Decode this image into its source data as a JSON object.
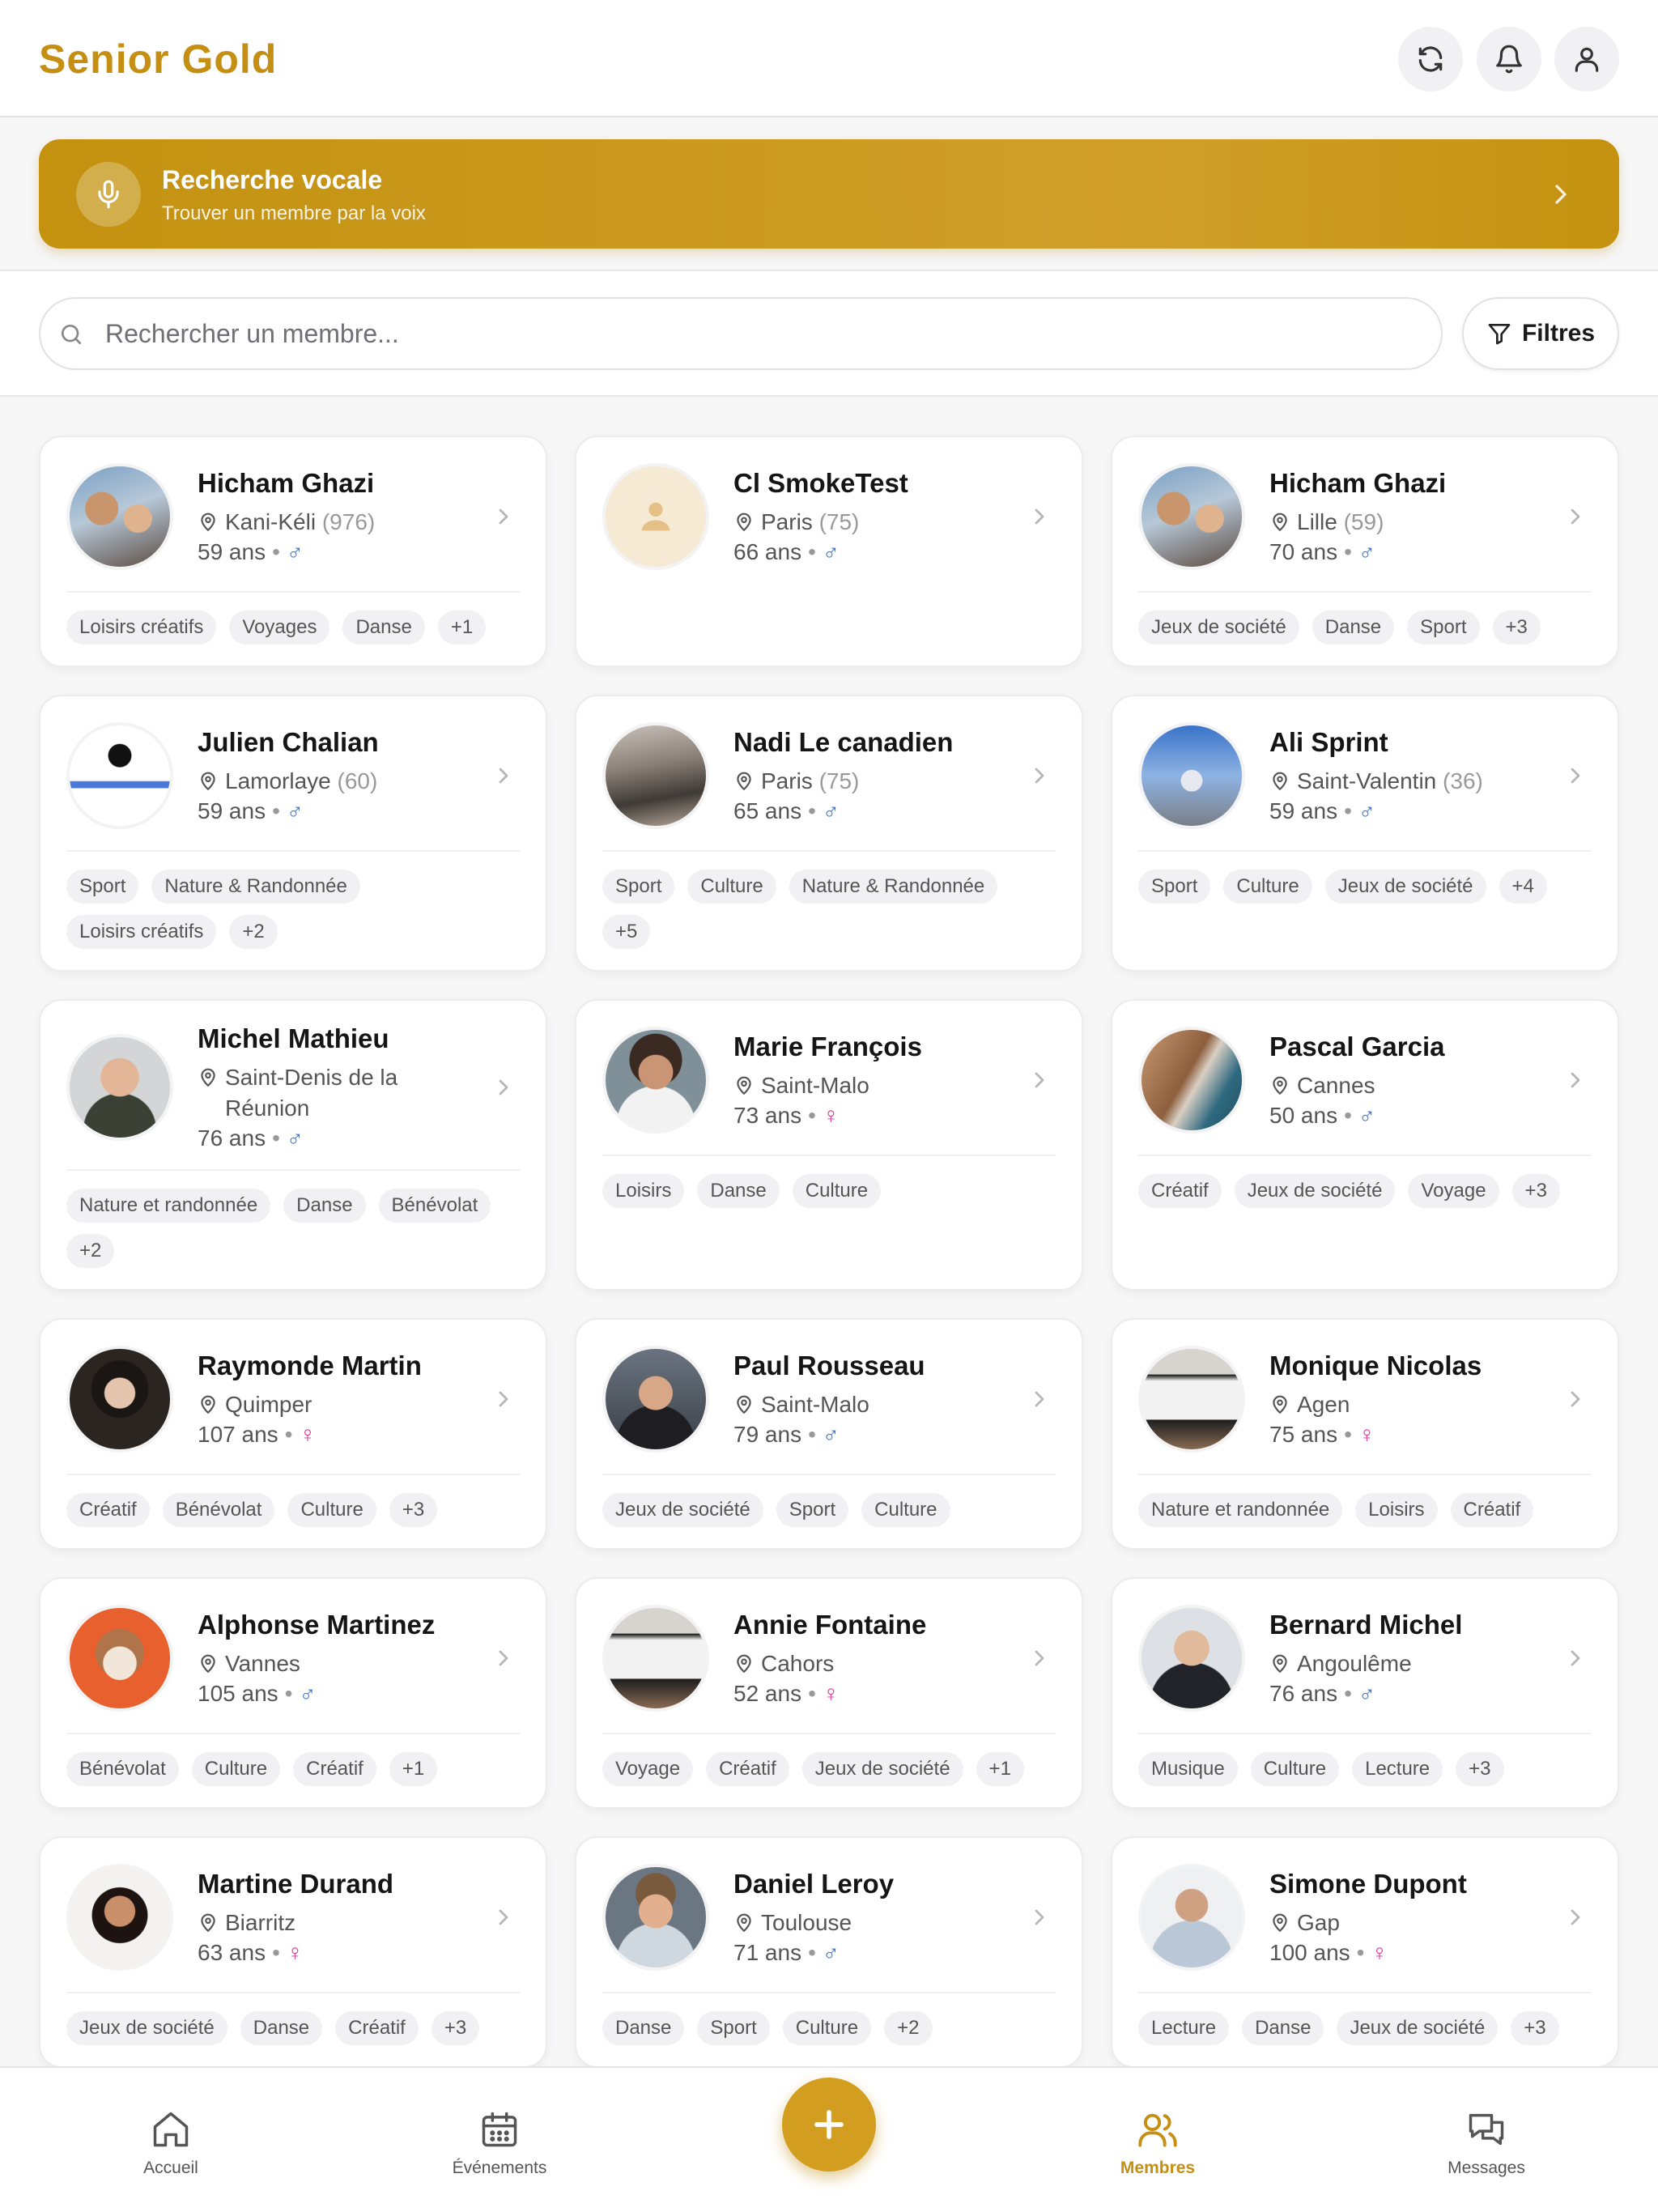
{
  "header": {
    "title": "Senior Gold",
    "icons": [
      "refresh-icon",
      "bell-icon",
      "user-icon"
    ]
  },
  "voice_search": {
    "title": "Recherche vocale",
    "subtitle": "Trouver un membre par la voix"
  },
  "search": {
    "placeholder": "Rechercher un membre...",
    "value": "",
    "filters_label": "Filtres"
  },
  "members": [
    {
      "name": "Hicham Ghazi",
      "city": "Kani-Kéli",
      "code": "(976)",
      "age": "59 ans",
      "gender": "♂",
      "gender_type": "male",
      "avatar": "photo-man-child",
      "tags": [
        "Loisirs créatifs",
        "Voyages",
        "Danse",
        "+1"
      ]
    },
    {
      "name": "Cl SmokeTest",
      "city": "Paris",
      "code": "(75)",
      "age": "66 ans",
      "gender": "♂",
      "gender_type": "male",
      "avatar": "default-user-icon",
      "tags": []
    },
    {
      "name": "Hicham Ghazi",
      "city": "Lille",
      "code": "(59)",
      "age": "70 ans",
      "gender": "♂",
      "gender_type": "male",
      "avatar": "photo-man-child",
      "tags": [
        "Jeux de société",
        "Danse",
        "Sport",
        "+3"
      ]
    },
    {
      "name": "Julien Chalian",
      "city": "Lamorlaye",
      "code": "(60)",
      "age": "59 ans",
      "gender": "♂",
      "gender_type": "male",
      "avatar": "photo-document",
      "tags": [
        "Sport",
        "Nature & Randonnée",
        "Loisirs créatifs",
        "+2"
      ]
    },
    {
      "name": "Nadi Le canadien",
      "city": "Paris",
      "code": "(75)",
      "age": "65 ans",
      "gender": "♂",
      "gender_type": "male",
      "avatar": "photo-station",
      "tags": [
        "Sport",
        "Culture",
        "Nature & Randonnée",
        "+5"
      ]
    },
    {
      "name": "Ali Sprint",
      "city": "Saint-Valentin",
      "code": "(36)",
      "age": "59 ans",
      "gender": "♂",
      "gender_type": "male",
      "avatar": "photo-runner",
      "tags": [
        "Sport",
        "Culture",
        "Jeux de société",
        "+4"
      ]
    },
    {
      "name": "Michel Mathieu",
      "city": "Saint-Denis de la Réunion",
      "code": "",
      "age": "76 ans",
      "gender": "♂",
      "gender_type": "male",
      "avatar": "photo-man-bald",
      "tags": [
        "Nature et randonnée",
        "Danse",
        "Bénévolat",
        "+2"
      ]
    },
    {
      "name": "Marie François",
      "city": "Saint-Malo",
      "code": "",
      "age": "73 ans",
      "gender": "♀",
      "gender_type": "female",
      "avatar": "photo-woman-smile",
      "tags": [
        "Loisirs",
        "Danse",
        "Culture"
      ]
    },
    {
      "name": "Pascal Garcia",
      "city": "Cannes",
      "code": "",
      "age": "50 ans",
      "gender": "♂",
      "gender_type": "male",
      "avatar": "photo-beach",
      "tags": [
        "Créatif",
        "Jeux de société",
        "Voyage",
        "+3"
      ]
    },
    {
      "name": "Raymonde Martin",
      "city": "Quimper",
      "code": "",
      "age": "107 ans",
      "gender": "♀",
      "gender_type": "female",
      "avatar": "photo-woman-dark",
      "tags": [
        "Créatif",
        "Bénévolat",
        "Culture",
        "+3"
      ]
    },
    {
      "name": "Paul Rousseau",
      "city": "Saint-Malo",
      "code": "",
      "age": "79 ans",
      "gender": "♂",
      "gender_type": "male",
      "avatar": "photo-man-beard",
      "tags": [
        "Jeux de société",
        "Sport",
        "Culture"
      ]
    },
    {
      "name": "Monique Nicolas",
      "city": "Agen",
      "code": "",
      "age": "75 ans",
      "gender": "♀",
      "gender_type": "female",
      "avatar": "photo-laptop",
      "tags": [
        "Nature et randonnée",
        "Loisirs",
        "Créatif"
      ]
    },
    {
      "name": "Alphonse Martinez",
      "city": "Vannes",
      "code": "",
      "age": "105 ans",
      "gender": "♂",
      "gender_type": "male",
      "avatar": "photo-dog",
      "tags": [
        "Bénévolat",
        "Culture",
        "Créatif",
        "+1"
      ]
    },
    {
      "name": "Annie Fontaine",
      "city": "Cahors",
      "code": "",
      "age": "52 ans",
      "gender": "♀",
      "gender_type": "female",
      "avatar": "photo-laptop",
      "tags": [
        "Voyage",
        "Créatif",
        "Jeux de société",
        "+1"
      ]
    },
    {
      "name": "Bernard Michel",
      "city": "Angoulême",
      "code": "",
      "age": "76 ans",
      "gender": "♂",
      "gender_type": "male",
      "avatar": "photo-man-suit",
      "tags": [
        "Musique",
        "Culture",
        "Lecture",
        "+3"
      ]
    },
    {
      "name": "Martine Durand",
      "city": "Biarritz",
      "code": "",
      "age": "63 ans",
      "gender": "♀",
      "gender_type": "female",
      "avatar": "photo-woman-brunette",
      "tags": [
        "Jeux de société",
        "Danse",
        "Créatif",
        "+3"
      ]
    },
    {
      "name": "Daniel Leroy",
      "city": "Toulouse",
      "code": "",
      "age": "71 ans",
      "gender": "♂",
      "gender_type": "male",
      "avatar": "photo-man-young",
      "tags": [
        "Danse",
        "Sport",
        "Culture",
        "+2"
      ]
    },
    {
      "name": "Simone Dupont",
      "city": "Gap",
      "code": "",
      "age": "100 ans",
      "gender": "♀",
      "gender_type": "female",
      "avatar": "photo-man-arms-crossed",
      "tags": [
        "Lecture",
        "Danse",
        "Jeux de société",
        "+3"
      ]
    }
  ],
  "nav": {
    "items": [
      {
        "label": "Accueil",
        "icon": "home-icon"
      },
      {
        "label": "Événements",
        "icon": "calendar-icon"
      },
      {
        "label": "Membres",
        "icon": "users-icon",
        "active": true
      },
      {
        "label": "Messages",
        "icon": "messages-icon"
      }
    ],
    "fab_icon": "plus-icon"
  },
  "colors": {
    "brand": "#c48f13",
    "brand_gradient": "#d09f2a",
    "male": "#3477e0",
    "female": "#e0339a"
  }
}
